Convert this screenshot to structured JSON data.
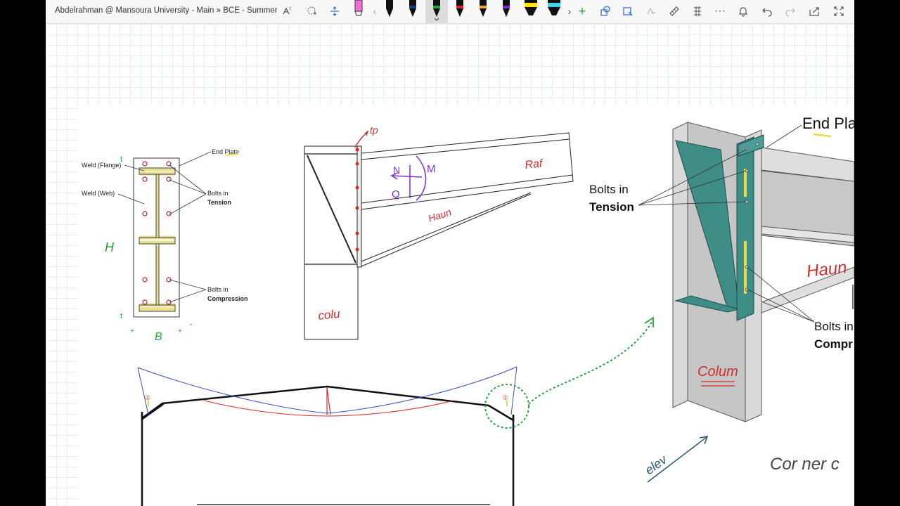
{
  "app": {
    "title": "Abdelrahman @ Mansoura University - Main » BCE - Summer"
  },
  "toolbar": {
    "icons": [
      "lasso-text-icon",
      "lasso-select-icon",
      "add-space-icon",
      "pen-pink",
      "chevron-left-icon",
      "pen-black",
      "pen-navy",
      "pen-green",
      "pen-red",
      "pen-orange",
      "pen-purple",
      "highlighter-yellow",
      "highlighter-aqua",
      "chevron-right-icon",
      "add-pen-icon",
      "shapes-icon",
      "convert-icon",
      "math-icon",
      "ruler-icon",
      "selection-icon",
      "more-icon",
      "bell-icon",
      "undo-icon",
      "redo-icon",
      "share-icon",
      "fullscreen-icon"
    ],
    "colors": {
      "pink": "#f06fd6",
      "black": "#111111",
      "navy": "#1a3d7c",
      "green": "#21a336",
      "red": "#e0202a",
      "orange": "#f5a623",
      "purple": "#7d2bd1",
      "yellow": "#ffe600",
      "aqua": "#43d1e6"
    }
  },
  "diagram1": {
    "labels": {
      "end_plate": "End Plate",
      "weld_flange": "Weld (Flange)",
      "weld_web": "Weld (Web)",
      "bolts_in": "Bolts in",
      "tension": "Tension",
      "compression": "Compression"
    },
    "handwriting": {
      "h": "H",
      "b": "B",
      "t1": "t",
      "t2": "t"
    }
  },
  "diagram2": {
    "handwriting": {
      "tp": "tp",
      "n": "N",
      "m": "M",
      "q": "Q",
      "rafter": "Raf",
      "haunch": "Haun",
      "column": "colu"
    }
  },
  "diagram3": {
    "labels": {
      "end_plate": "End Pla",
      "bolts_in_1": "Bolts in",
      "tension": "Tension",
      "bolts_in_2": "Bolts in",
      "compression": "Compr"
    },
    "handwriting": {
      "haunch": "Haun",
      "column": "Colum",
      "elev": "elev",
      "corner": "Cor ner c"
    }
  },
  "frame": {
    "markers": [
      "①",
      "①"
    ]
  }
}
